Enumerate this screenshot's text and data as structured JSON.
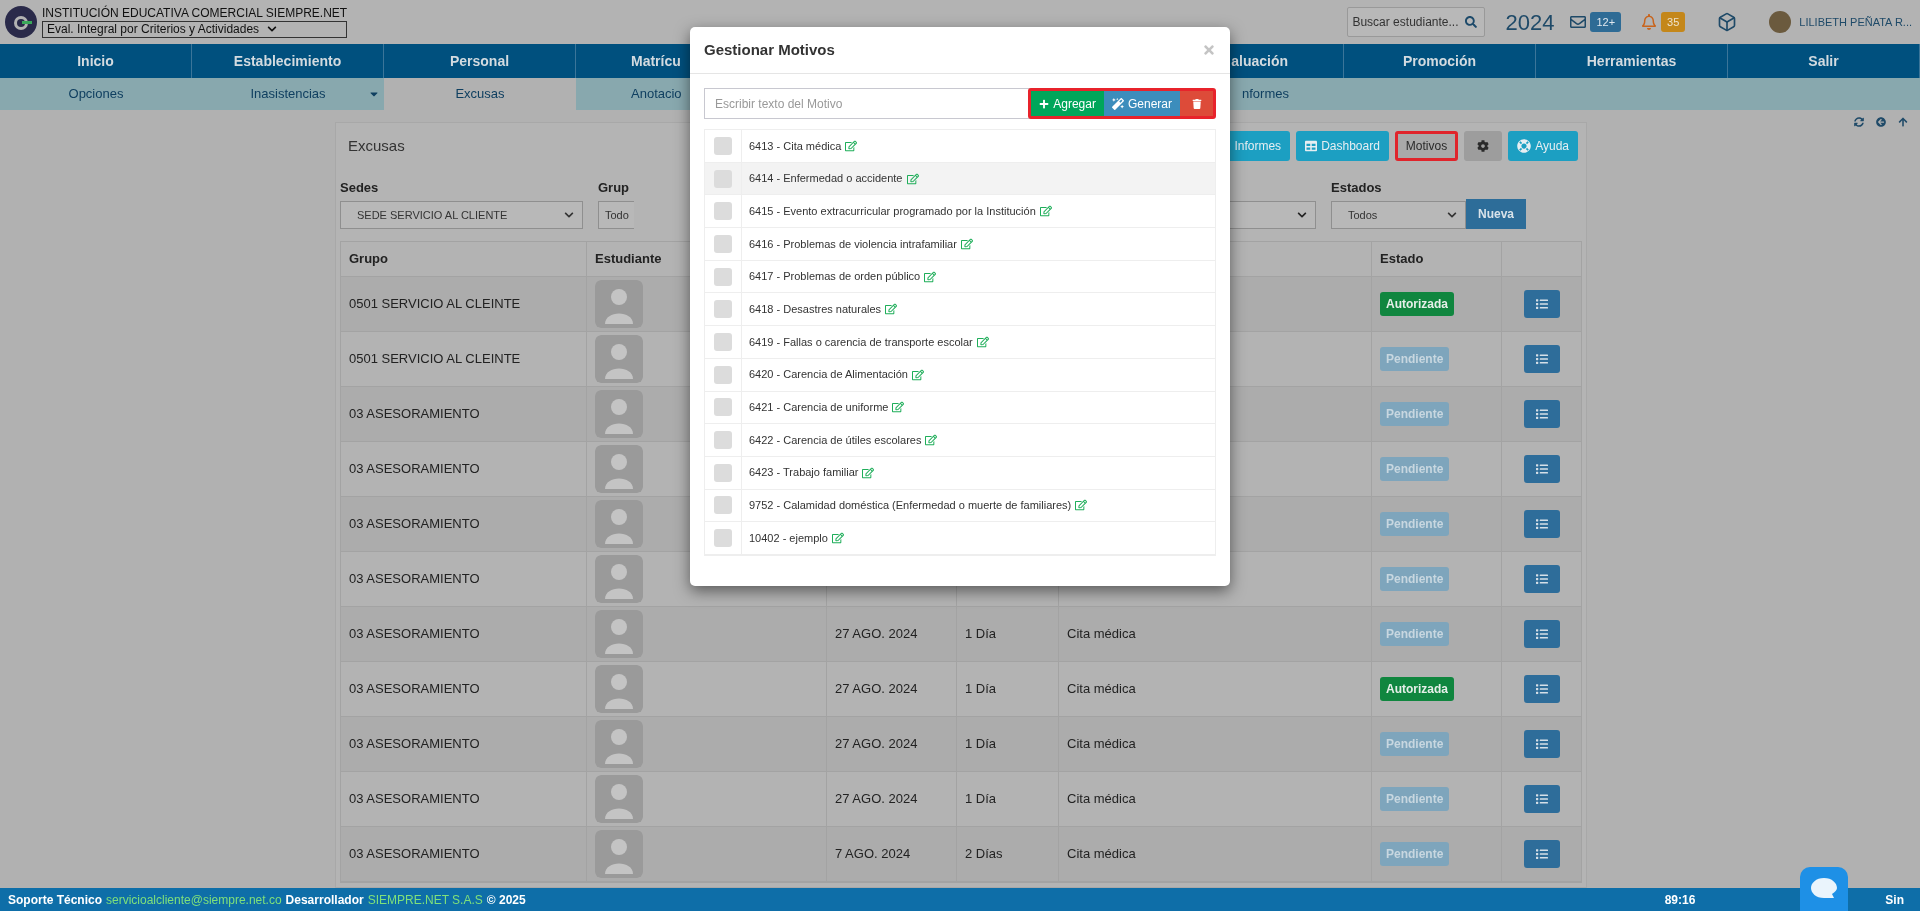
{
  "header": {
    "institution": "INSTITUCIÓN EDUCATIVA COMERCIAL SIEMPRE.NET",
    "mode_select": "Eval. Integral por Criterios y Actividades",
    "search": {
      "placeholder": "Buscar estudiante..."
    },
    "year": "2024",
    "messages_badge": "12+",
    "alerts_badge": "35",
    "user": "LILIBETH PEÑATA R..."
  },
  "nav": [
    {
      "label": "Inicio",
      "cut_right": false,
      "cut_left": false
    },
    {
      "label": "Establecimiento",
      "cut_right": false,
      "cut_left": false
    },
    {
      "label": "Personal",
      "cut_right": false,
      "cut_left": false
    },
    {
      "label": "Matrícu",
      "cut_right": true,
      "cut_left": false
    },
    {
      "label": "aluación",
      "cut_right": false,
      "cut_left": true
    },
    {
      "label": "Promoción",
      "cut_right": false,
      "cut_left": false
    },
    {
      "label": "Herramientas",
      "cut_right": false,
      "cut_left": false
    },
    {
      "label": "Salir",
      "cut_right": false,
      "cut_left": false
    }
  ],
  "subnav": [
    {
      "label": "Opciones",
      "selected": false,
      "dropdown": false,
      "cut_right": false,
      "cut_left": false
    },
    {
      "label": "Inasistencias",
      "selected": false,
      "dropdown": true,
      "cut_right": false,
      "cut_left": false
    },
    {
      "label": "Excusas",
      "selected": true,
      "dropdown": false,
      "cut_right": false,
      "cut_left": false
    },
    {
      "label": "Anotacio",
      "selected": false,
      "dropdown": false,
      "cut_right": true,
      "cut_left": false
    },
    {
      "label": "nformes",
      "selected": false,
      "dropdown": false,
      "cut_right": false,
      "cut_left": true
    }
  ],
  "panel": {
    "title": "Excusas",
    "toolbar": [
      {
        "kind": "report",
        "label": "Informes",
        "highlighted": false
      },
      {
        "kind": "dashboard",
        "label": "Dashboard",
        "highlighted": false
      },
      {
        "kind": "plain",
        "label": "Motivos",
        "highlighted": true
      },
      {
        "kind": "settings",
        "highlighted": false
      },
      {
        "kind": "help",
        "label": "Ayuda",
        "highlighted": false
      }
    ],
    "filters": {
      "sedes": {
        "label": "Sedes",
        "value": "SEDE SERVICIO AL CLIENTE"
      },
      "grupo": {
        "label": "Grup",
        "value": "Todo"
      },
      "estados": {
        "label": "Estados",
        "value": "Todos"
      },
      "new_button": "Nueva"
    }
  },
  "table": {
    "headers": {
      "grupo": "Grupo",
      "estudiante": "Estudiante",
      "estado": "Estado"
    },
    "rows": [
      {
        "grupo": "0501 SERVICIO AL CLEINTE",
        "estado": "Autorizada",
        "authorized": true
      },
      {
        "grupo": "0501 SERVICIO AL CLEINTE",
        "estado": "Pendiente",
        "authorized": false
      },
      {
        "grupo": "03 ASESORAMIENTO",
        "estado": "Pendiente",
        "authorized": false
      },
      {
        "grupo": "03 ASESORAMIENTO",
        "estado": "Pendiente",
        "authorized": false
      },
      {
        "grupo": "03 ASESORAMIENTO",
        "estado": "Pendiente",
        "authorized": false
      },
      {
        "grupo": "03 ASESORAMIENTO",
        "estado": "Pendiente",
        "authorized": false
      },
      {
        "grupo": "03 ASESORAMIENTO",
        "date": "27 AGO. 2024",
        "days": "1 Día",
        "motivo": "Cita médica",
        "estado": "Pendiente",
        "authorized": false
      },
      {
        "grupo": "03 ASESORAMIENTO",
        "date": "27 AGO. 2024",
        "days": "1 Día",
        "motivo": "Cita médica",
        "estado": "Autorizada",
        "authorized": true
      },
      {
        "grupo": "03 ASESORAMIENTO",
        "date": "27 AGO. 2024",
        "days": "1 Día",
        "motivo": "Cita médica",
        "estado": "Pendiente",
        "authorized": false
      },
      {
        "grupo": "03 ASESORAMIENTO",
        "date": "27 AGO. 2024",
        "days": "1 Día",
        "motivo": "Cita médica",
        "estado": "Pendiente",
        "authorized": false
      },
      {
        "grupo": "03 ASESORAMIENTO",
        "date": "7 AGO. 2024",
        "days": "2 Días",
        "motivo": "Cita médica",
        "estado": "Pendiente",
        "authorized": false
      }
    ]
  },
  "dialog": {
    "title": "Gestionar Motivos",
    "input": {
      "placeholder": "Escribir texto del Motivo"
    },
    "add_button": "Agregar",
    "generate_button": "Generar",
    "actions_highlighted": true,
    "items": [
      {
        "label": "6413 - Cita médica",
        "checked": false,
        "highlighted": false
      },
      {
        "label": "6414 - Enfermedad o accidente",
        "checked": false,
        "highlighted": true
      },
      {
        "label": "6415 - Evento extracurricular programado por la Institución",
        "checked": false,
        "highlighted": false
      },
      {
        "label": "6416 - Problemas de violencia intrafamiliar",
        "checked": false,
        "highlighted": false
      },
      {
        "label": "6417 - Problemas de orden público",
        "checked": false,
        "highlighted": false
      },
      {
        "label": "6418 - Desastres naturales",
        "checked": false,
        "highlighted": false
      },
      {
        "label": "6419 - Fallas o carencia de transporte escolar",
        "checked": false,
        "highlighted": false
      },
      {
        "label": "6420 - Carencia de Alimentación",
        "checked": false,
        "highlighted": false
      },
      {
        "label": "6421 - Carencia de uniforme",
        "checked": false,
        "highlighted": false
      },
      {
        "label": "6422 - Carencia de útiles escolares",
        "checked": false,
        "highlighted": false
      },
      {
        "label": "6423 - Trabajo familiar",
        "checked": false,
        "highlighted": false
      },
      {
        "label": "9752 - Calamidad doméstica (Enfermedad o muerte de familiares)",
        "checked": false,
        "highlighted": false
      },
      {
        "label": "10402 - ejemplo",
        "checked": false,
        "highlighted": false
      }
    ]
  },
  "footer": {
    "support_label": "Soporte Técnico",
    "support_email": "servicioalcliente@siempre.net.co",
    "developer_label": "Desarrollador",
    "developer": "SIEMPRE.NET S.A.S",
    "copyright": "© 2025",
    "time": "89:16",
    "brand": "Sin"
  }
}
